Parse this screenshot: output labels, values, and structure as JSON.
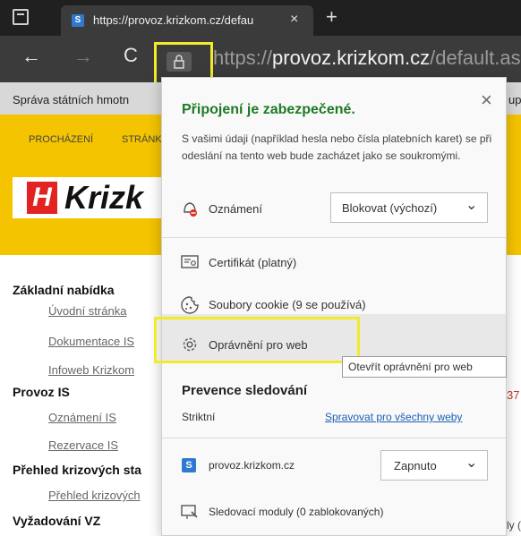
{
  "tab": {
    "favicon": "S",
    "title": "https://provoz.krizkom.cz/defau",
    "close": "×",
    "new_tab": "+"
  },
  "nav": {
    "back": "←",
    "forward": "→",
    "reload": "C",
    "url_scheme": "https://",
    "url_domain": "provoz.krizkom.cz",
    "url_path": "/default.aspx"
  },
  "page": {
    "strip_text": "Správa státních hmotn",
    "strip_right": "up",
    "nav_items": [
      "PROCHÁZENÍ",
      "STRÁNK"
    ],
    "logo_mark": "H",
    "logo_text": "Krizk",
    "menu": [
      {
        "type": "heading",
        "text": "Základní nabídka"
      },
      {
        "type": "link",
        "text": "Úvodní stránka"
      },
      {
        "type": "link",
        "text": "Dokumentace IS"
      },
      {
        "type": "link",
        "text": "Infoweb Krizkom"
      },
      {
        "type": "heading",
        "text": "Provoz IS"
      },
      {
        "type": "link",
        "text": "Oznámení IS"
      },
      {
        "type": "link",
        "text": "Rezervace IS"
      },
      {
        "type": "heading",
        "text": "Přehled krizových sta"
      },
      {
        "type": "link",
        "text": "Přehled krizových"
      },
      {
        "type": "heading",
        "text": "Vyžadování VZ"
      }
    ],
    "right_number": "37",
    "right_bottom": "ly ("
  },
  "popup": {
    "close": "×",
    "title": "Připojení je zabezpečené.",
    "description": "S vašimi údaji (například hesla nebo čísla platebních karet) se při odeslání na tento web bude zacházet jako se soukromými.",
    "notifications_label": "Oznámení",
    "notifications_value": "Blokovat (výchozí)",
    "certificate_label": "Certifikát (platný)",
    "cookies_label": "Soubory cookie (9 se používá)",
    "permissions_label": "Oprávnění pro web",
    "tooltip": "Otevřít oprávnění pro web",
    "tracking_title": "Prevence sledování",
    "tracking_mode": "Striktní",
    "tracking_manage_link": "Spravovat pro všechny weby",
    "site_label": "provoz.krizkom.cz",
    "site_value": "Zapnuto",
    "trackers_label": "Sledovací moduly (0 zablokovaných)",
    "chevron": "⌄"
  },
  "colors": {
    "secure_green": "#1d7a24",
    "link_blue": "#1a5fb4",
    "highlight_yellow": "#f2ea2a",
    "page_yellow": "#f4c400",
    "logo_red": "#e32222"
  }
}
